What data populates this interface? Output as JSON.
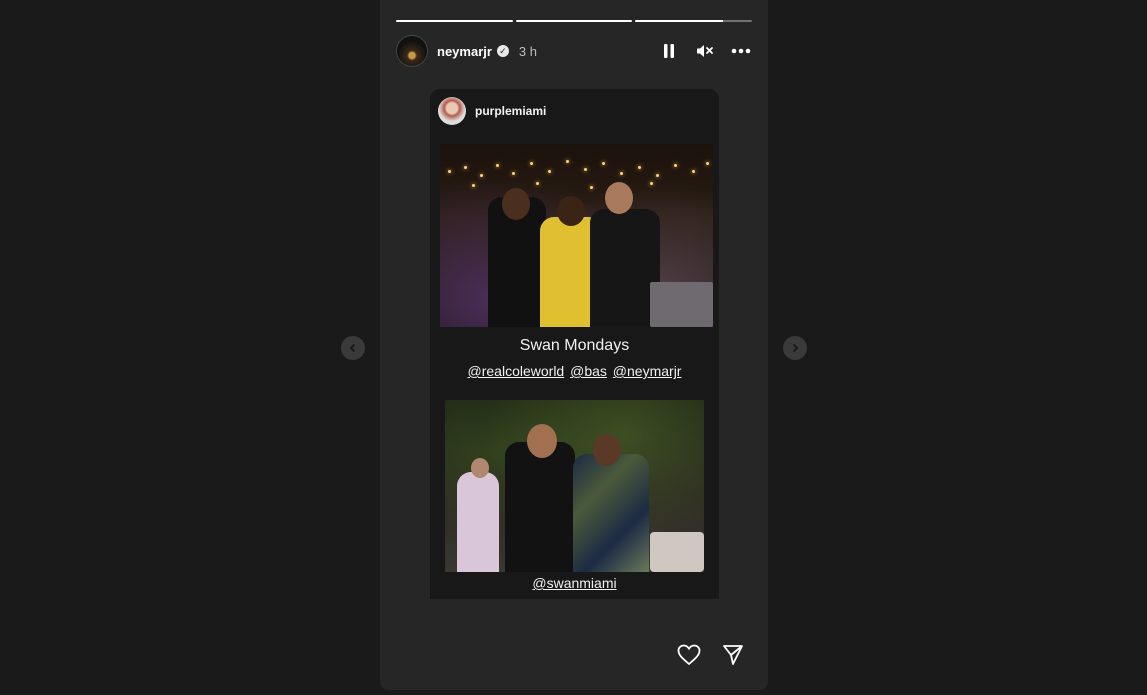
{
  "story": {
    "progress_segments": [
      1.0,
      1.0,
      0.75
    ],
    "username": "neymarjr",
    "verified": true,
    "time": "3 h"
  },
  "card": {
    "username": "purplemiami",
    "caption": "Swan Mondays",
    "mentions": [
      "@realcoleworld",
      "@bas",
      "@neymarjr"
    ],
    "bottom_mention": "@swanmiami"
  },
  "icons": {
    "pause": "pause-icon",
    "mute": "muted-speaker-icon",
    "more": "more-options-icon",
    "like": "heart-icon",
    "share": "send-icon",
    "prev": "chevron-left-icon",
    "next": "chevron-right-icon"
  }
}
